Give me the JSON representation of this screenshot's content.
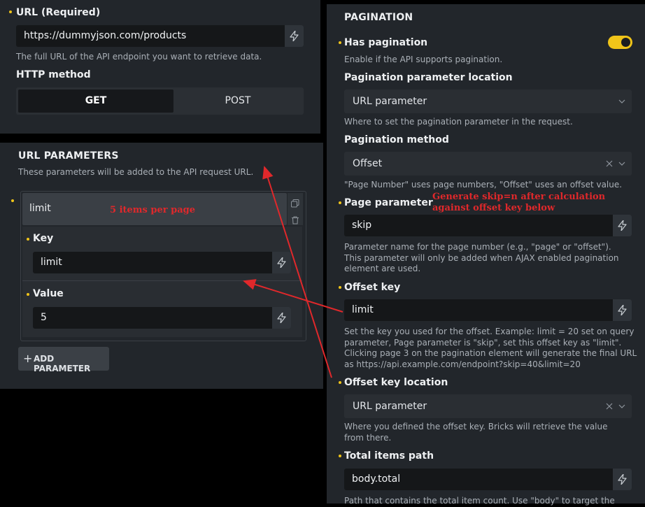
{
  "url_section": {
    "label": "URL (Required)",
    "value": "https://dummyjson.com/products",
    "help": "The full URL of the API endpoint you want to retrieve data.",
    "method_label": "HTTP method",
    "methods": [
      "GET",
      "POST"
    ],
    "selected_method": "GET"
  },
  "url_params": {
    "title": "URL PARAMETERS",
    "help": "These parameters will be added to the API request URL.",
    "item_title": "limit",
    "key_label": "Key",
    "key_value": "limit",
    "value_label": "Value",
    "value_value": "5",
    "add_button": "ADD PARAMETER"
  },
  "pagination": {
    "title": "PAGINATION",
    "has_pagination_label": "Has pagination",
    "has_pagination_on": true,
    "has_pagination_help": "Enable if the API supports pagination.",
    "param_location_label": "Pagination parameter location",
    "param_location_value": "URL parameter",
    "param_location_help": "Where to set the pagination parameter in the request.",
    "method_label": "Pagination method",
    "method_value": "Offset",
    "method_help": "\"Page Number\" uses page numbers, \"Offset\" uses an offset value.",
    "page_param_label": "Page parameter",
    "page_param_value": "skip",
    "page_param_help": "Parameter name for the page number (e.g., \"page\" or \"offset\"). This parameter will only be added when AJAX enabled pagination element are used.",
    "offset_key_label": "Offset key",
    "offset_key_value": "limit",
    "offset_key_help": "Set the key you used for the offset. Example: limit = 20 set on query parameter, Page parameter is \"skip\", set this offset key as \"limit\". Clicking page 3 on the pagination element will generate the final URL as https://api.example.com/endpoint?skip=40&limit=20",
    "offset_loc_label": "Offset key location",
    "offset_loc_value": "URL parameter",
    "offset_loc_help": "Where you defined the offset key. Bricks will retrieve the value from there.",
    "total_path_label": "Total items path",
    "total_path_value": "body.total",
    "total_path_help": "Path that contains the total item count. Use \"body\" to target the"
  },
  "annotations": {
    "items_per_page": "5 items per page",
    "skip_line1": "Generate skip=n after calculation",
    "skip_line2": "against offset key below"
  },
  "colors": {
    "accent": "#f0c419",
    "annotation": "#e0282b",
    "panel": "#22262b"
  },
  "icons": [
    "dynamic-data-bolt-icon",
    "chevron-down-icon",
    "clear-x-icon",
    "duplicate-icon",
    "trash-icon",
    "plus-icon"
  ]
}
